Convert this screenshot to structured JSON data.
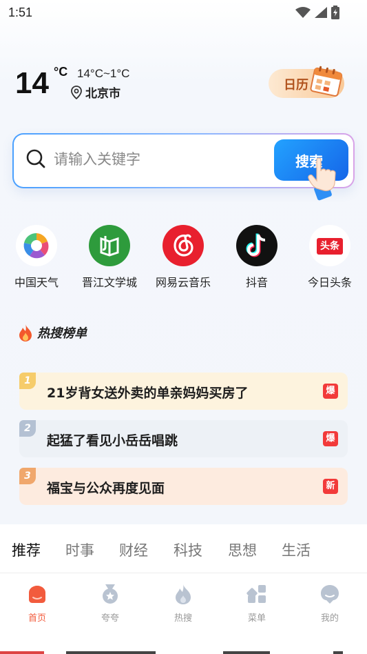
{
  "status_bar": {
    "time": "1:51"
  },
  "weather": {
    "temperature": "14",
    "unit": "°C",
    "range": "14°C~1°C",
    "city": "北京市"
  },
  "calendar": {
    "label": "日历"
  },
  "search": {
    "placeholder": "请输入关键字",
    "button_label": "搜索"
  },
  "shortcuts": [
    {
      "label": "中国天气",
      "icon": "china-weather-icon"
    },
    {
      "label": "晋江文学城",
      "icon": "jinjiang-icon"
    },
    {
      "label": "网易云音乐",
      "icon": "netease-music-icon"
    },
    {
      "label": "抖音",
      "icon": "douyin-icon"
    },
    {
      "label": "今日头条",
      "icon": "toutiao-icon",
      "icon_text": "头条"
    }
  ],
  "hot": {
    "title": "热搜榜单",
    "items": [
      {
        "rank": "1",
        "text": "21岁背女送外卖的单亲妈妈买房了",
        "tag": "爆",
        "bg": "#fdf3de",
        "badge": "#f6cc6a",
        "tag_color": "#f23a3a"
      },
      {
        "rank": "2",
        "text": "起猛了看见小岳岳唱跳",
        "tag": "爆",
        "bg": "#edf1f6",
        "badge": "#b4c1d3",
        "tag_color": "#f23a3a"
      },
      {
        "rank": "3",
        "text": "福宝与公众再度见面",
        "tag": "新",
        "bg": "#fdebdf",
        "badge": "#f0a76c",
        "tag_color": "#f23a3a"
      }
    ]
  },
  "tabs": [
    "推荐",
    "时事",
    "财经",
    "科技",
    "思想",
    "生活"
  ],
  "nav": [
    {
      "label": "首页",
      "icon": "home-icon",
      "active": true
    },
    {
      "label": "夸夸",
      "icon": "medal-icon",
      "active": false
    },
    {
      "label": "热搜",
      "icon": "flame-icon",
      "active": false
    },
    {
      "label": "菜单",
      "icon": "grid-icon",
      "active": false
    },
    {
      "label": "我的",
      "icon": "profile-icon",
      "active": false
    }
  ],
  "colors": {
    "accent": "#f25b3d",
    "search_button": "#1a7ef0"
  }
}
